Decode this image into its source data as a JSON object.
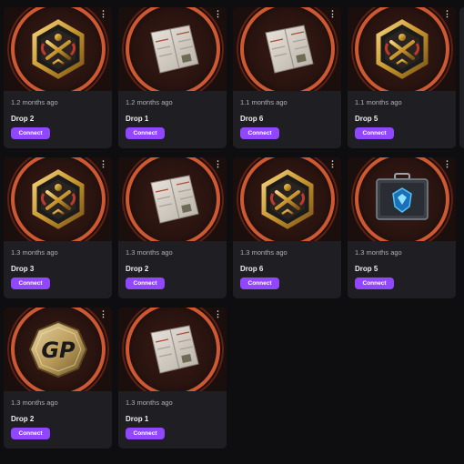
{
  "drops": [
    {
      "time": "1.2 months ago",
      "title": "Drop 2",
      "button": "Connect",
      "icon": "gold-emblem-icon"
    },
    {
      "time": "1.2 months ago",
      "title": "Drop 1",
      "button": "Connect",
      "icon": "booklet-icon"
    },
    {
      "time": "1.1 months ago",
      "title": "Drop 6",
      "button": "Connect",
      "icon": "booklet-icon"
    },
    {
      "time": "1.1 months ago",
      "title": "Drop 5",
      "button": "Connect",
      "icon": "gold-emblem-icon"
    },
    {
      "time": "1.3 months ago",
      "title": "Drop 3",
      "button": "Connect",
      "icon": "gold-emblem-icon"
    },
    {
      "time": "1.3 months ago",
      "title": "Drop 2",
      "button": "Connect",
      "icon": "booklet-icon"
    },
    {
      "time": "1.3 months ago",
      "title": "Drop 6",
      "button": "Connect",
      "icon": "gold-emblem-icon"
    },
    {
      "time": "1.3 months ago",
      "title": "Drop 5",
      "button": "Connect",
      "icon": "case-icon"
    },
    {
      "time": "1.3 months ago",
      "title": "Drop 2",
      "button": "Connect",
      "icon": "gp-coin-icon"
    },
    {
      "time": "1.3 months ago",
      "title": "Drop 1",
      "button": "Connect",
      "icon": "booklet-icon"
    }
  ],
  "colors": {
    "accent": "#9147ff",
    "card": "#1f1f23",
    "ring": "#e06035"
  }
}
